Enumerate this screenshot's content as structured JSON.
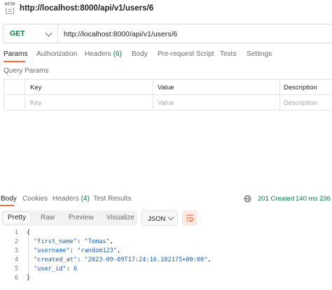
{
  "window": {
    "title": "http://localhost:8000/api/v1/users/6",
    "icon": "http-file-icon"
  },
  "request": {
    "method": "GET",
    "url": "http://localhost:8000/api/v1/users/6",
    "method_color": "#0a7b3f"
  },
  "request_tabs": [
    {
      "label": "Params",
      "count": "",
      "active": true
    },
    {
      "label": "Authorization",
      "count": "",
      "active": false
    },
    {
      "label": "Headers ",
      "count": "(6)",
      "active": false
    },
    {
      "label": "Body",
      "count": "",
      "active": false
    },
    {
      "label": "Pre-request Script",
      "count": "",
      "active": false
    },
    {
      "label": "Tests",
      "count": "",
      "active": false
    },
    {
      "label": "Settings",
      "count": "",
      "active": false
    }
  ],
  "query_params": {
    "title": "Query Params",
    "columns": [
      "Key",
      "Value",
      "Description"
    ],
    "placeholders": [
      "Key",
      "Value",
      "Description"
    ]
  },
  "response_tabs": [
    {
      "label": "Body",
      "count": "",
      "active": true
    },
    {
      "label": "Cookies",
      "count": "",
      "active": false
    },
    {
      "label": "Headers ",
      "count": "(4)",
      "active": false
    },
    {
      "label": "Test Results",
      "count": "",
      "active": false
    }
  ],
  "response_meta": {
    "status": "201 Created",
    "time": "140 ms",
    "size": "236",
    "color": "#0a7b3f"
  },
  "view_modes": [
    {
      "label": "Pretty",
      "active": true
    },
    {
      "label": "Raw",
      "active": false
    },
    {
      "label": "Preview",
      "active": false
    },
    {
      "label": "Visualize",
      "active": false
    }
  ],
  "format": "JSON",
  "accent_color": "#ff6c37",
  "response_body": {
    "line_numbers": [
      "1",
      "2",
      "3",
      "4",
      "5",
      "6"
    ],
    "open_brace": "{",
    "close_brace": "}",
    "fields": [
      {
        "key": "\"first_name\"",
        "value": "\"Tomas\"",
        "comma": ","
      },
      {
        "key": "\"username\"",
        "value": "\"random123\"",
        "comma": ","
      },
      {
        "key": "\"created_at\"",
        "value": "\"2023-09-09T17:24:16.182175+00:00\"",
        "comma": ","
      },
      {
        "key": "\"user_id\"",
        "value": "6",
        "comma": ""
      }
    ]
  }
}
